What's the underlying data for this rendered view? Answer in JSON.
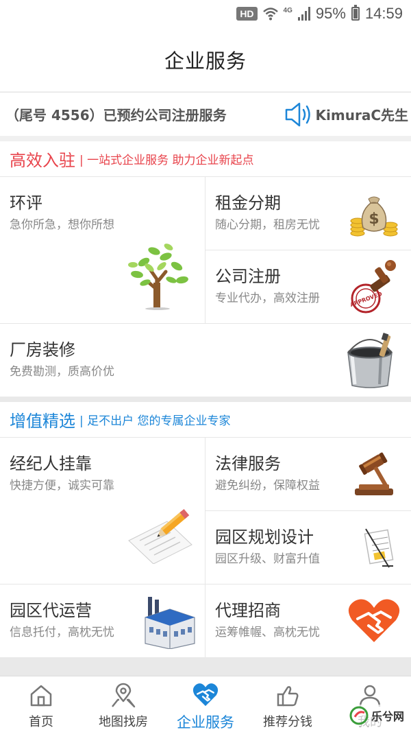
{
  "status_bar": {
    "hd": "HD",
    "network": "4G",
    "battery": "95%",
    "time": "14:59"
  },
  "header": {
    "title": "企业服务"
  },
  "notice": {
    "text": "（尾号 4556）已预约公司注册服务",
    "user": "KimuraC先生"
  },
  "section1": {
    "title": "高效入驻",
    "subtitle": "| 一站式企业服务 助力企业新起点",
    "title_color": "#e8434b",
    "cards": [
      {
        "title": "环评",
        "subtitle": "急你所急，想你所想",
        "icon": "tree-icon"
      },
      {
        "title": "租金分期",
        "subtitle": "随心分期，租房无忧",
        "icon": "money-bag-icon"
      },
      {
        "title": "公司注册",
        "subtitle": "专业代办，高效注册",
        "icon": "approved-stamp-icon"
      },
      {
        "title": "厂房装修",
        "subtitle": "免费勘测，质高价优",
        "icon": "paint-bucket-icon"
      }
    ]
  },
  "section2": {
    "title": "增值精选",
    "subtitle": "| 足不出户 您的专属企业专家",
    "title_color": "#1c86d8",
    "cards": [
      {
        "title": "经纪人挂靠",
        "subtitle": "快捷方便，诚实可靠",
        "icon": "pencil-paper-icon"
      },
      {
        "title": "法律服务",
        "subtitle": "避免纠纷，保障权益",
        "icon": "gavel-icon"
      },
      {
        "title": "园区规划设计",
        "subtitle": "园区升级、财富升值",
        "icon": "blueprint-icon"
      },
      {
        "title": "园区代运营",
        "subtitle": "信息托付，高枕无忧",
        "icon": "factory-icon"
      },
      {
        "title": "代理招商",
        "subtitle": "运筹帷幄、高枕无忧",
        "icon": "handshake-heart-icon"
      }
    ]
  },
  "tabbar": {
    "items": [
      {
        "label": "首页",
        "icon": "home-icon",
        "active": false
      },
      {
        "label": "地图找房",
        "icon": "map-pin-icon",
        "active": false
      },
      {
        "label": "企业服务",
        "icon": "handshake-heart-icon",
        "active": true
      },
      {
        "label": "推荐分钱",
        "icon": "thumbs-up-icon",
        "active": false
      },
      {
        "label": "我的",
        "icon": "user-icon",
        "active": false
      }
    ]
  },
  "watermark": {
    "text": "乐兮网"
  },
  "colors": {
    "accent_blue": "#1c86d8",
    "accent_red": "#e8434b",
    "background": "#f0f0f0"
  }
}
